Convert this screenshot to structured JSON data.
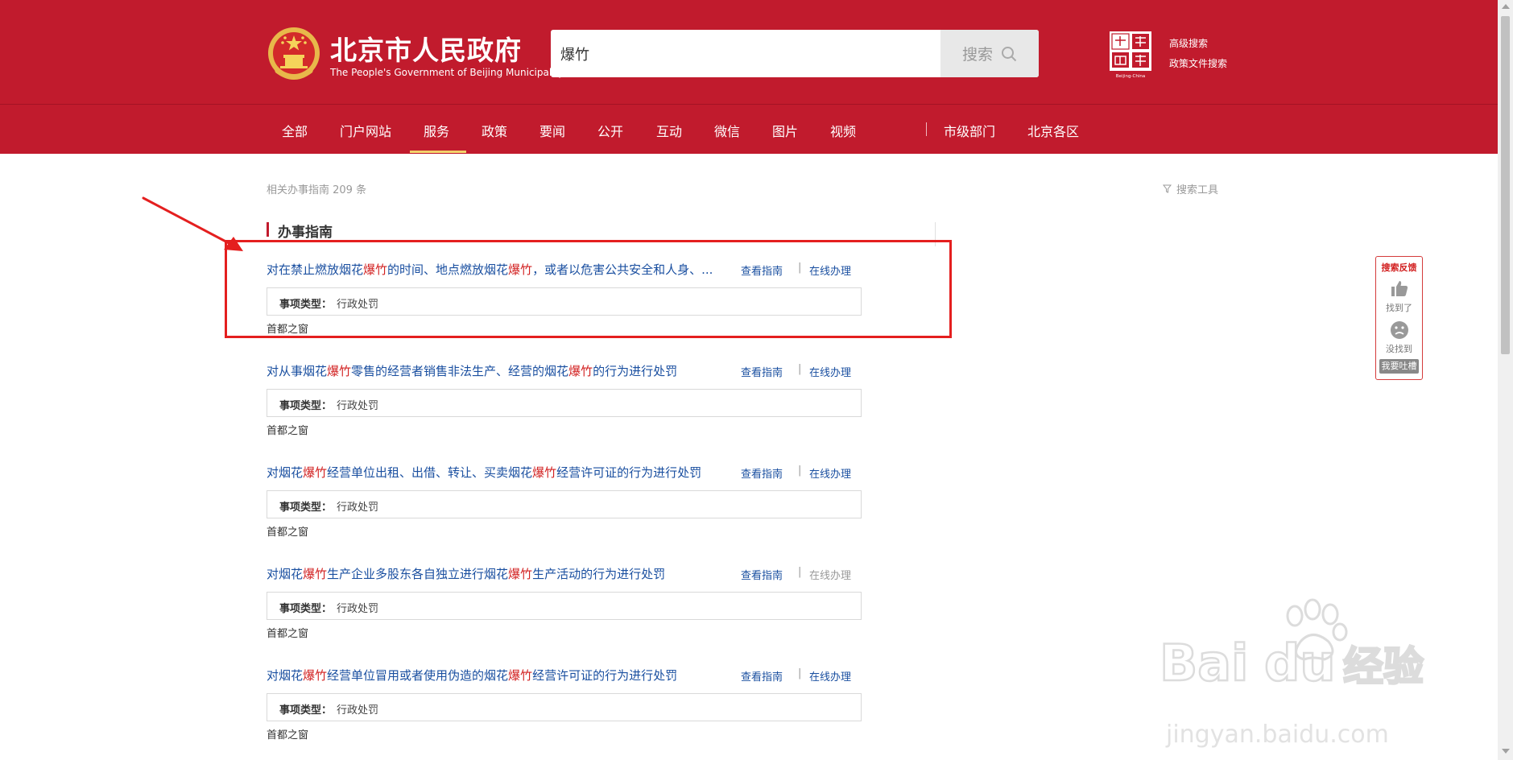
{
  "header": {
    "site_title": "北京市人民政府",
    "site_subtitle": "The People's Government of Beijing Municipality",
    "search_value": "爆竹",
    "search_button": "搜索",
    "advanced_search": "高级搜索",
    "policy_search": "政策文件搜索",
    "capital_logo_caption": "Beijing-China"
  },
  "nav": {
    "items": [
      "全部",
      "门户网站",
      "服务",
      "政策",
      "要闻",
      "公开",
      "互动",
      "微信",
      "图片",
      "视频"
    ],
    "right_items": [
      "市级部门",
      "北京各区"
    ],
    "active": "服务"
  },
  "results": {
    "count_text": "相关办事指南 209 条",
    "tools": "搜索工具",
    "section_title": "办事指南",
    "view_guide_label": "查看指南",
    "online_label": "在线办理",
    "type_label": "事项类型：",
    "items": [
      {
        "title_parts": [
          "对在禁止燃放烟花",
          "爆竹",
          "的时间、地点燃放烟花",
          "爆竹",
          "，或者以危害公共安全和人身、..."
        ],
        "type": "行政处罚",
        "source": "首都之窗",
        "online_disabled": false
      },
      {
        "title_parts": [
          "对从事烟花",
          "爆竹",
          "零售的经营者销售非法生产、经营的烟花",
          "爆竹",
          "的行为进行处罚"
        ],
        "type": "行政处罚",
        "source": "首都之窗",
        "online_disabled": false
      },
      {
        "title_parts": [
          "对烟花",
          "爆竹",
          "经营单位出租、出借、转让、买卖烟花",
          "爆竹",
          "经营许可证的行为进行处罚"
        ],
        "type": "行政处罚",
        "source": "首都之窗",
        "online_disabled": false
      },
      {
        "title_parts": [
          "对烟花",
          "爆竹",
          "生产企业多股东各自独立进行烟花",
          "爆竹",
          "生产活动的行为进行处罚"
        ],
        "type": "行政处罚",
        "source": "首都之窗",
        "online_disabled": true
      },
      {
        "title_parts": [
          "对烟花",
          "爆竹",
          "经营单位冒用或者使用伪造的烟花",
          "爆竹",
          "经营许可证的行为进行处罚"
        ],
        "type": "行政处罚",
        "source": "首都之窗",
        "online_disabled": false
      }
    ]
  },
  "feedback": {
    "title": "搜索反馈",
    "found": "找到了",
    "not_found": "没找到",
    "complain": "我要吐槽"
  },
  "watermark": {
    "text": "jingyan.baidu.com"
  },
  "colors": {
    "header_red": "#c11b2d",
    "link_blue": "#1a4fa0",
    "highlight_red": "#d22020",
    "annotation_red": "#e41f1f"
  }
}
